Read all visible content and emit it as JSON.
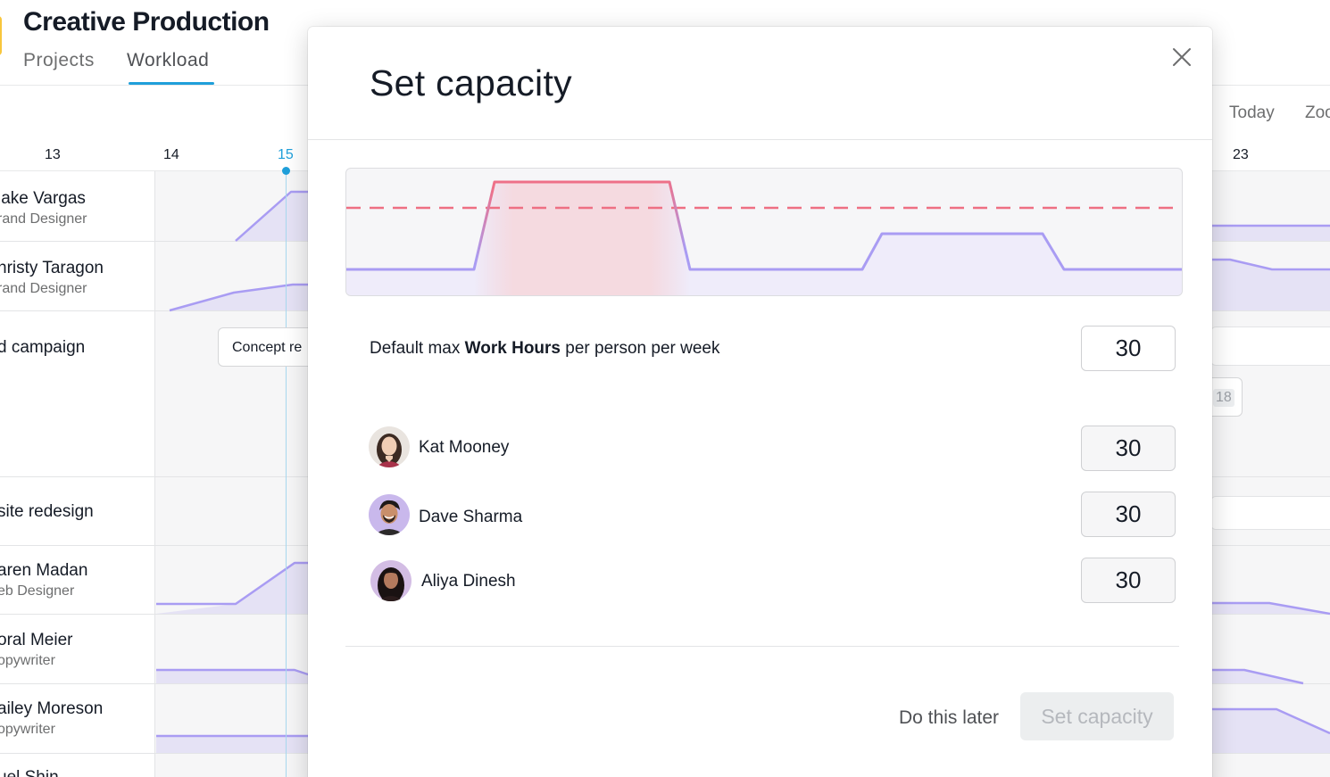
{
  "app": {
    "title": "Creative Production",
    "tabs": [
      {
        "label": "Projects",
        "active": false
      },
      {
        "label": "Workload",
        "active": true
      }
    ],
    "toolbar": {
      "today_label": "Today",
      "zoom_label": "Zoo"
    },
    "dates": [
      "13",
      "14",
      "15",
      "23"
    ],
    "today_date": "15",
    "accent_color": "#1f9fda",
    "rows": [
      {
        "name": "lake Vargas",
        "role": "rand Designer"
      },
      {
        "name": "hristy Taragon",
        "role": "rand Designer"
      },
      {
        "name": "d campaign",
        "chip": "Concept re"
      },
      {
        "name": "site redesign"
      },
      {
        "name": "aren Madan",
        "role": "eb Designer"
      },
      {
        "name": "oral Meier",
        "role": "opywriter"
      },
      {
        "name": "ailey Moreson",
        "role": "opywriter"
      },
      {
        "name": "uel Shin"
      }
    ],
    "right_chip_value": "18"
  },
  "modal": {
    "title": "Set capacity",
    "close_icon": "close-icon",
    "default_label_pre": "Default max ",
    "default_label_bold": "Work Hours",
    "default_label_post": " per person per week",
    "default_value": "30",
    "members": [
      {
        "name": "Kat Mooney",
        "hours": "30",
        "avatar_bg": "#e9e4df",
        "hair": "#3c2a22",
        "skin": "#f0cdb4",
        "shirt": "#a8324a"
      },
      {
        "name": "Dave Sharma",
        "hours": "30",
        "avatar_bg": "#c9b8ec",
        "hair": "#1e1a18",
        "skin": "#c98f6b",
        "shirt": "#2c2a2a"
      },
      {
        "name": "Aliya Dinesh",
        "hours": "30",
        "avatar_bg": "#d3bde4",
        "hair": "#1a1212",
        "skin": "#b47a5e",
        "shirt": "#2a1b1b"
      }
    ],
    "buttons": {
      "later": "Do this later",
      "submit": "Set capacity"
    },
    "colors": {
      "over_capacity": "#ee6f83",
      "workload_line": "#a99cf3",
      "threshold": "#ee6f83"
    }
  }
}
